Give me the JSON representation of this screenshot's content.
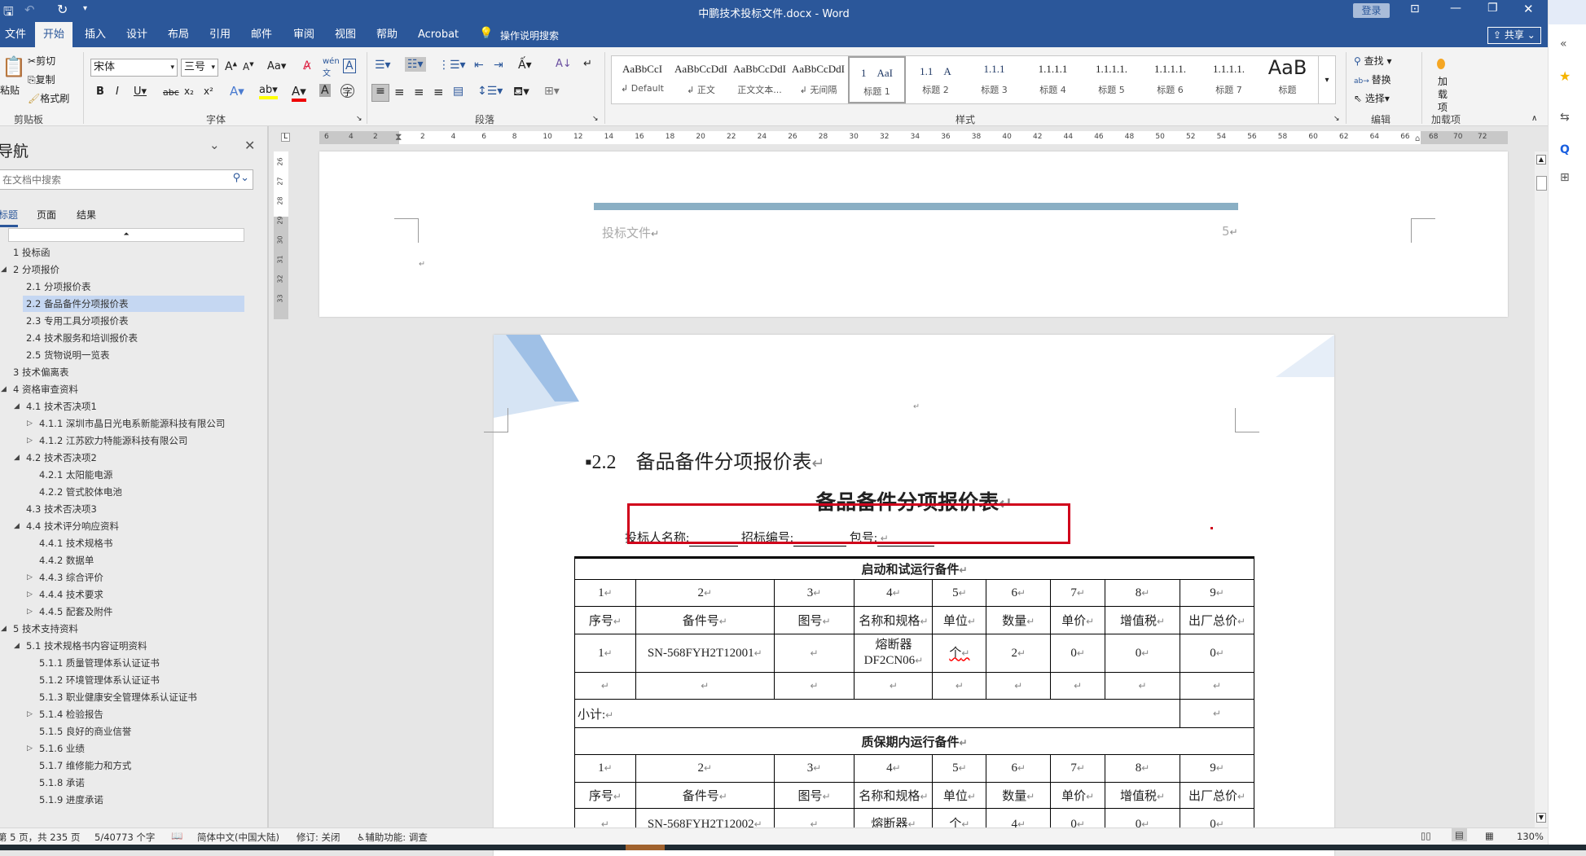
{
  "titlebar": {
    "title": "中鹏技术投标文件.docx - Word",
    "login": "登录"
  },
  "tabs": [
    "文件",
    "开始",
    "插入",
    "设计",
    "布局",
    "引用",
    "邮件",
    "审阅",
    "视图",
    "帮助",
    "Acrobat"
  ],
  "tell_me": "操作说明搜索",
  "share": "共享",
  "ribbon": {
    "clipboard": {
      "paste": "粘贴",
      "cut": "剪切",
      "copy": "复制",
      "format_painter": "格式刷",
      "label": "剪贴板"
    },
    "font": {
      "name": "宋体",
      "size": "三号",
      "label": "字体"
    },
    "paragraph": {
      "label": "段落"
    },
    "styles": {
      "label": "样式",
      "items": [
        {
          "preview": "AaBbCcI",
          "name": "↲ Default"
        },
        {
          "preview": "AaBbCcDdI",
          "name": "↲ 正文"
        },
        {
          "preview": "AaBbCcDdI",
          "name": "正文文本..."
        },
        {
          "preview": "AaBbCcDdI",
          "name": "↲ 无间隔"
        },
        {
          "preview": "1　AaI",
          "name": "标题 1"
        },
        {
          "preview": "1.1　A",
          "name": "标题 2"
        },
        {
          "preview": "1.1.1",
          "name": "标题 3"
        },
        {
          "preview": "1.1.1.1",
          "name": "标题 4"
        },
        {
          "preview": "1.1.1.1.",
          "name": "标题 5"
        },
        {
          "preview": "1.1.1.1.",
          "name": "标题 6"
        },
        {
          "preview": "1.1.1.1.",
          "name": "标题 7"
        },
        {
          "preview": "AaB",
          "name": "标题"
        }
      ]
    },
    "editing": {
      "find": "查找",
      "replace": "替换",
      "select": "选择",
      "label": "编辑"
    },
    "addins": {
      "button": "加载项",
      "label": "加载项"
    }
  },
  "nav": {
    "title": "导航",
    "search_placeholder": "在文档中搜索",
    "tabs": [
      "标题",
      "页面",
      "结果"
    ],
    "items": [
      {
        "t": "1 投标函",
        "l": 0,
        "a": ""
      },
      {
        "t": "2 分项报价",
        "l": 0,
        "a": "open"
      },
      {
        "t": "2.1 分项报价表",
        "l": 1,
        "a": ""
      },
      {
        "t": "2.2 备品备件分项报价表",
        "l": 1,
        "a": "",
        "sel": true
      },
      {
        "t": "2.3 专用工具分项报价表",
        "l": 1,
        "a": ""
      },
      {
        "t": "2.4 技术服务和培训报价表",
        "l": 1,
        "a": ""
      },
      {
        "t": "2.5 货物说明一览表",
        "l": 1,
        "a": ""
      },
      {
        "t": "3 技术偏离表",
        "l": 0,
        "a": ""
      },
      {
        "t": "4 资格审查资料",
        "l": 0,
        "a": "open"
      },
      {
        "t": "4.1 技术否决项1",
        "l": 1,
        "a": "open"
      },
      {
        "t": "4.1.1 深圳市晶日光电系新能源科技有限公司",
        "l": 2,
        "a": "closed"
      },
      {
        "t": "4.1.2 江苏欧力特能源科技有限公司",
        "l": 2,
        "a": "closed"
      },
      {
        "t": "4.2 技术否决项2",
        "l": 1,
        "a": "open"
      },
      {
        "t": "4.2.1 太阳能电源",
        "l": 2,
        "a": ""
      },
      {
        "t": "4.2.2 管式胶体电池",
        "l": 2,
        "a": ""
      },
      {
        "t": "4.3 技术否决项3",
        "l": 1,
        "a": ""
      },
      {
        "t": "4.4 技术评分响应资料",
        "l": 1,
        "a": "open"
      },
      {
        "t": "4.4.1 技术规格书",
        "l": 2,
        "a": ""
      },
      {
        "t": "4.4.2 数据单",
        "l": 2,
        "a": ""
      },
      {
        "t": "4.4.3 综合评价",
        "l": 2,
        "a": "closed"
      },
      {
        "t": "4.4.4 技术要求",
        "l": 2,
        "a": "closed"
      },
      {
        "t": "4.4.5 配套及附件",
        "l": 2,
        "a": "closed"
      },
      {
        "t": "5 技术支持资料",
        "l": 0,
        "a": "open"
      },
      {
        "t": "5.1 技术规格书内容证明资料",
        "l": 1,
        "a": "open"
      },
      {
        "t": "5.1.1 质量管理体系认证证书",
        "l": 2,
        "a": ""
      },
      {
        "t": "5.1.2 环境管理体系认证证书",
        "l": 2,
        "a": ""
      },
      {
        "t": "5.1.3 职业健康安全管理体系认证证书",
        "l": 2,
        "a": ""
      },
      {
        "t": "5.1.4 检验报告",
        "l": 2,
        "a": "closed"
      },
      {
        "t": "5.1.5 良好的商业信誉",
        "l": 2,
        "a": ""
      },
      {
        "t": "5.1.6 业绩",
        "l": 2,
        "a": "closed"
      },
      {
        "t": "5.1.7 维修能力和方式",
        "l": 2,
        "a": ""
      },
      {
        "t": "5.1.8 承诺",
        "l": 2,
        "a": ""
      },
      {
        "t": "5.1.9 进度承诺",
        "l": 2,
        "a": ""
      }
    ]
  },
  "ruler": {
    "left": [
      "6",
      "4",
      "2"
    ],
    "main": [
      "2",
      "4",
      "6",
      "8",
      "10",
      "12",
      "14",
      "16",
      "18",
      "20",
      "22",
      "24",
      "26",
      "28",
      "30",
      "32",
      "34",
      "36",
      "38",
      "40",
      "42",
      "44",
      "46",
      "48",
      "50",
      "52",
      "54",
      "56",
      "58",
      "60",
      "62",
      "64",
      "66"
    ],
    "right": [
      "68",
      "70",
      "72"
    ],
    "vertical": [
      "26",
      "27",
      "28",
      "29",
      "30",
      "31",
      "32",
      "33"
    ]
  },
  "doc": {
    "header_left": "投标文件",
    "header_right": "5",
    "heading": "▪2.2　备品备件分项报价表",
    "table_title": "备品备件分项报价表",
    "bidder_line": {
      "name": "投标人名称:",
      "bid_no": "招标编号:",
      "lot": "包号:"
    },
    "sections": [
      {
        "title": "启动和试运行备件",
        "nums": [
          "1",
          "2",
          "3",
          "4",
          "5",
          "6",
          "7",
          "8",
          "9"
        ],
        "headers": [
          "序号",
          "备件号",
          "图号",
          "名称和规格",
          "单位",
          "数量",
          "单价",
          "增值税",
          "出厂总价"
        ],
        "rows": [
          [
            "1",
            "SN-568FYH2T12001",
            "",
            "熔断器\nDF2CN06",
            "个",
            "2",
            "0",
            "0",
            "0"
          ],
          [
            "",
            "",
            "",
            "",
            "",
            "",
            "",
            "",
            ""
          ]
        ],
        "subtotal": "小计:"
      },
      {
        "title": "质保期内运行备件",
        "nums": [
          "1",
          "2",
          "3",
          "4",
          "5",
          "6",
          "7",
          "8",
          "9"
        ],
        "headers": [
          "序号",
          "备件号",
          "图号",
          "名称和规格",
          "单位",
          "数量",
          "单价",
          "增值税",
          "出厂总价"
        ],
        "rows": [
          [
            "",
            "SN-568FYH2T12002",
            "",
            "熔断器",
            "个",
            "4",
            "0",
            "0",
            "0"
          ]
        ]
      }
    ]
  },
  "status": {
    "page": "第 5 页，共 235 页",
    "words": "5/40773 个字",
    "language": "简体中文(中国大陆)",
    "track": "修订: 关闭",
    "accessibility": "辅助功能: 调查",
    "zoom": "130%"
  },
  "colors": {
    "titlebar": "#2b579a",
    "selection": "#c5d7f2",
    "highlight_box": "#d0021b",
    "header_bar": "#8aafc4"
  }
}
